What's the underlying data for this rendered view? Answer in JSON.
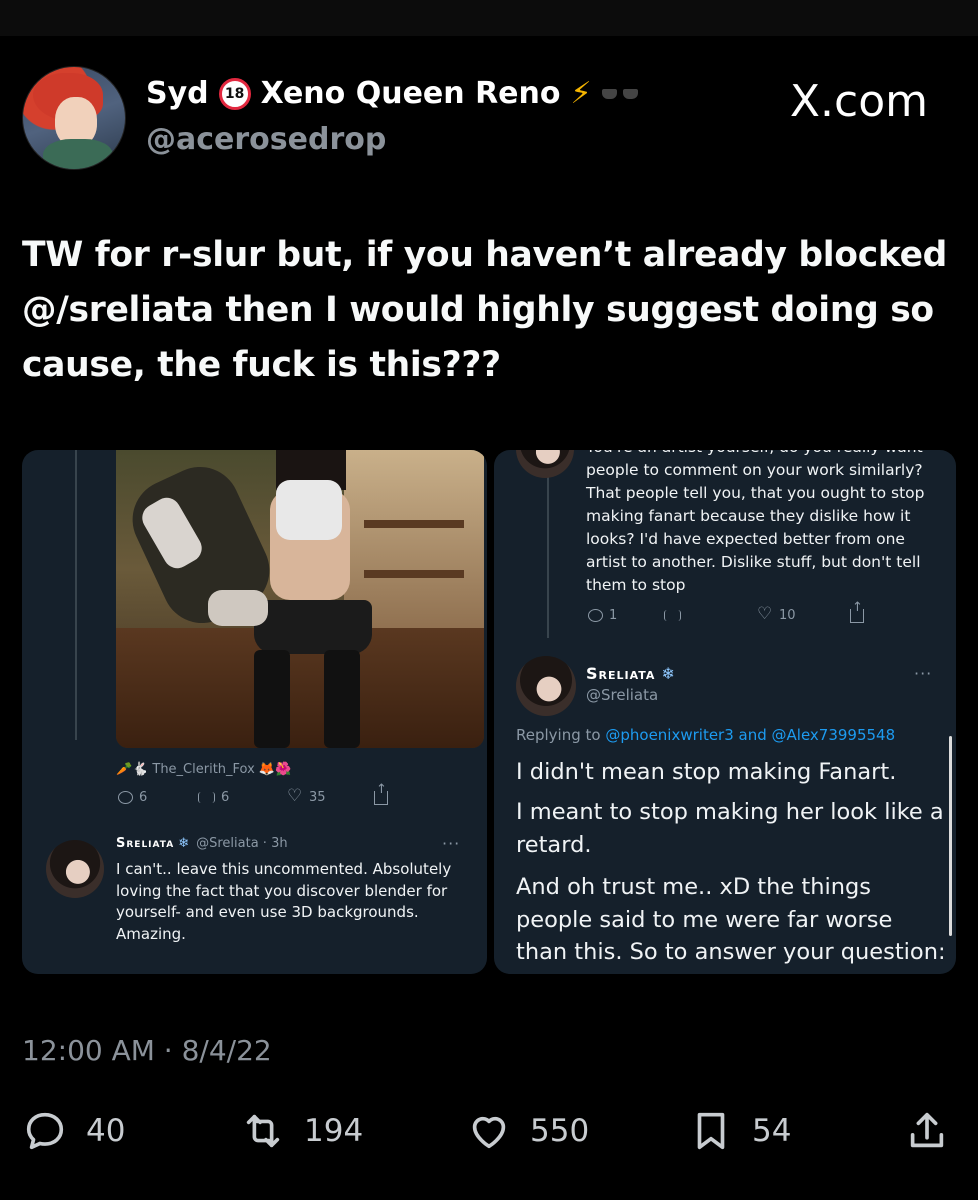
{
  "author": {
    "display_name_1": "Syd",
    "badge_18": "18",
    "display_name_2": "Xeno Queen Reno",
    "bolt": "⚡",
    "handle": "@acerosedrop"
  },
  "site_label": "X.com",
  "tweet_text": "TW for r-slur but, if you haven’t already blocked @/sreliata then I would highly suggest doing so cause, the fuck is this???",
  "left_panel": {
    "credit_prefix": "🥕🐇",
    "credit_name": "The_Clerith_Fox",
    "credit_suffix": "🦊🌺",
    "actions": {
      "replies": "6",
      "retweets": "6",
      "likes": "35"
    },
    "reply": {
      "name": "Sreliata",
      "flake": "❄",
      "handle_time": "@Sreliata · 3h",
      "more": "···",
      "body": "I can't.. leave this uncommented. Absolutely loving the fact that you discover blender for yourself- and even use 3D backgrounds. Amazing."
    }
  },
  "right_panel": {
    "cut_line": "You're an artist yourself, do you really want",
    "top_text": "people to comment on your work similarly? That people tell you, that you ought to stop making fanart because they dislike how it looks? I'd have expected better from one artist to another. Dislike stuff, but don't tell them to stop",
    "actions": {
      "replies": "1",
      "likes": "10"
    },
    "name": "Sreliata",
    "flake": "❄",
    "handle": "@Sreliata",
    "more": "···",
    "replying_prefix": "Replying to",
    "replying_users": "@phoenixwriter3 and @Alex73995548",
    "line1": "I didn't mean stop making Fanart.",
    "line2": "I meant to stop making her look like a retard.",
    "line3": "And oh trust me.. xD the things people said to me were far worse than this. So to answer your question: yes"
  },
  "timestamp": "12:00 AM · 8/4/22",
  "stats": {
    "replies": "40",
    "retweets": "194",
    "likes": "550",
    "bookmarks": "54"
  }
}
